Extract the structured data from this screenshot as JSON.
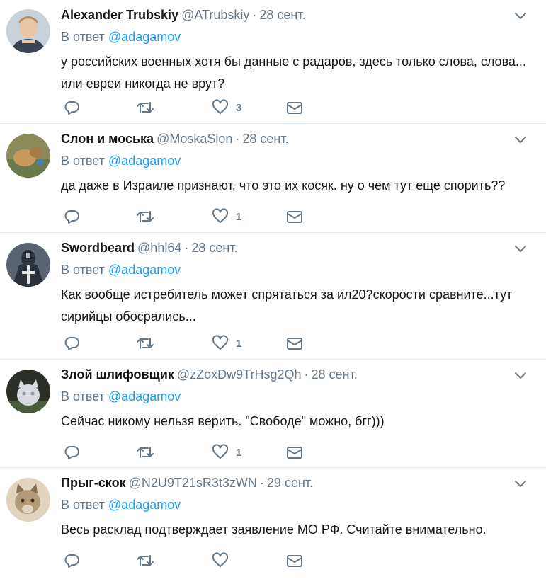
{
  "tweets": [
    {
      "name": "Alexander Trubskiy",
      "handle": "@ATrubskiy",
      "separator": "·",
      "time": "28 сент.",
      "reply_prefix": "В ответ",
      "reply_to": "@adagamov",
      "text": "у российских военных хотя бы данные с радаров, здесь только слова, слова... или евреи никогда не врут?",
      "likes": "3",
      "avatar_colors": [
        "#c9d2da",
        "#e8c7a8",
        "#3a4452"
      ]
    },
    {
      "name": "Слон и моська",
      "handle": "@MoskaSlon",
      "separator": "·",
      "time": "28 сент.",
      "reply_prefix": "В ответ",
      "reply_to": "@adagamov",
      "text": "да даже в Израиле признают, что это их косяк. ну о чем тут еще спорить??",
      "likes": "1",
      "avatar_colors": [
        "#8a8a5a",
        "#c79a5c",
        "#6a7a4a"
      ]
    },
    {
      "name": "Swordbeard",
      "handle": "@hhl64",
      "separator": "·",
      "time": "28 сент.",
      "reply_prefix": "В ответ",
      "reply_to": "@adagamov",
      "text": "Как вообще истребитель может спрятаться за ил20?скорости сравните...тут сирийцы обосрались...",
      "likes": "1",
      "avatar_colors": [
        "#5a6470",
        "#2c323a",
        "#b5bcc4"
      ]
    },
    {
      "name": "Злой шлифовщик",
      "handle": "@zZoxDw9TrHsg2Qh",
      "separator": "·",
      "time": "28 сент.",
      "reply_prefix": "В ответ",
      "reply_to": "@adagamov",
      "text": "Сейчас никому нельзя верить. \"Свободе\" можно, бгг)))",
      "likes": "1",
      "avatar_colors": [
        "#2a3028",
        "#d9dbe0",
        "#8e9aa3"
      ]
    },
    {
      "name": "Прыг-скок",
      "handle": "@N2U9T21sR3t3zWN",
      "separator": "·",
      "time": "29 сент.",
      "reply_prefix": "В ответ",
      "reply_to": "@adagamov",
      "text": "Весь расклад подтверждает заявление МО РФ. Считайте внимательно.",
      "likes": "",
      "avatar_colors": [
        "#b59a7a",
        "#8a6c4e",
        "#e2d3bf"
      ]
    }
  ],
  "icons": {
    "reply": "reply-icon",
    "retweet": "retweet-icon",
    "like": "heart-icon",
    "dm": "envelope-icon",
    "menu": "chevron-down-icon"
  },
  "colors": {
    "link": "#1da1f2",
    "secondary": "#657786",
    "text": "#14171a",
    "divider": "#e6ecf0"
  }
}
